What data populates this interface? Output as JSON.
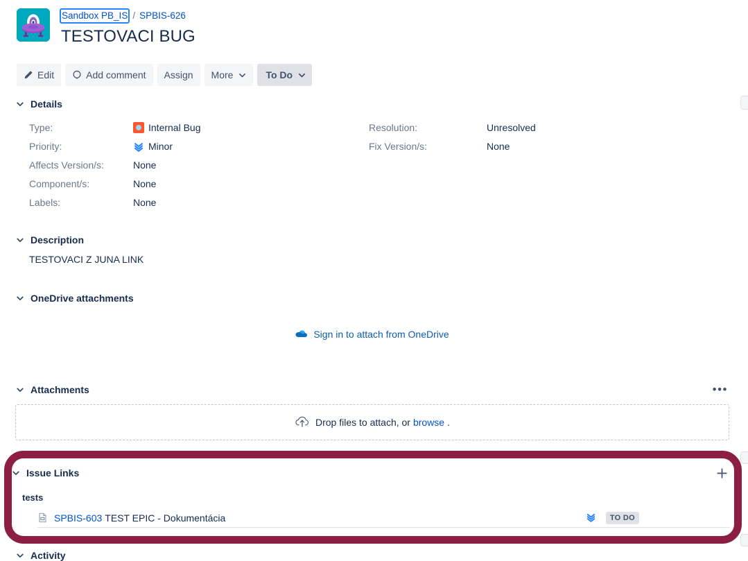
{
  "header": {
    "avatar_alt": "project-avatar-ufo",
    "breadcrumb": {
      "project": "Sandbox PB_IS",
      "separator": "/",
      "issue_key": "SPBIS-626"
    },
    "title": "TESTOVACI BUG"
  },
  "toolbar": {
    "edit_label": "Edit",
    "add_comment_label": "Add comment",
    "assign_label": "Assign",
    "more_label": "More",
    "status_label": "To Do"
  },
  "details": {
    "heading": "Details",
    "left": [
      {
        "label": "Type:",
        "value": "Internal Bug",
        "icon": "internal-bug-icon"
      },
      {
        "label": "Priority:",
        "value": "Minor",
        "icon": "minor-priority-icon"
      },
      {
        "label": "Affects Version/s:",
        "value": "None",
        "icon": ""
      },
      {
        "label": "Component/s:",
        "value": "None",
        "icon": ""
      },
      {
        "label": "Labels:",
        "value": "None",
        "icon": ""
      }
    ],
    "right": [
      {
        "label": "Resolution:",
        "value": "Unresolved"
      },
      {
        "label": "Fix Version/s:",
        "value": "None"
      }
    ]
  },
  "description": {
    "heading": "Description",
    "body": "TESTOVACI Z JUNA LINK"
  },
  "onedrive": {
    "heading": "OneDrive attachments",
    "signin_label": "Sign in to attach from OneDrive",
    "icon": "onedrive-cloud-icon"
  },
  "attachments": {
    "heading": "Attachments",
    "more_menu": "•••",
    "dropzone_text": "Drop files to attach, or",
    "dropzone_link": "browse",
    "dropzone_period": ".",
    "icon": "upload-cloud-icon"
  },
  "issue_links": {
    "heading": "Issue Links",
    "add_icon": "plus-icon",
    "groups": [
      {
        "label": "tests",
        "items": [
          {
            "icon": "epic-issue-icon",
            "key": "SPBIS-603",
            "summary": "TEST EPIC - Dokumentácia",
            "priority_icon": "minor-priority-icon",
            "status": "TO DO"
          }
        ]
      }
    ]
  },
  "activity": {
    "heading": "Activity"
  },
  "colors": {
    "highlight_border": "#8C1D43",
    "link": "#0052CC",
    "bug_icon": "#FF5630",
    "priority_icon": "#2684FF",
    "avatar_bg": "#01A9C0",
    "lozenge_bg": "#DFE1E6"
  }
}
